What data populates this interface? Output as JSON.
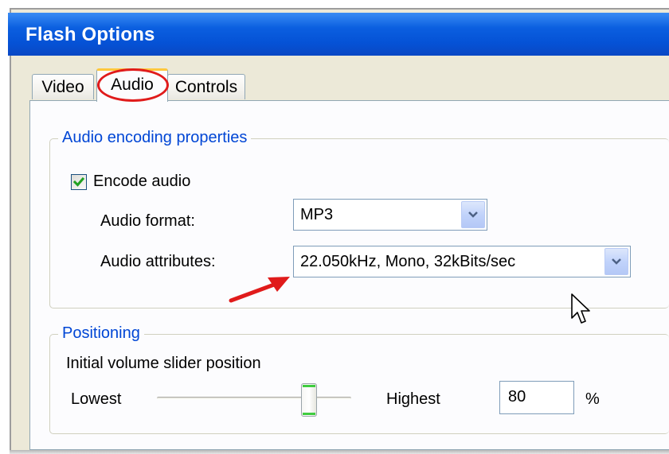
{
  "window": {
    "title": "Flash Options"
  },
  "tabs": [
    {
      "label": "Video",
      "active": false
    },
    {
      "label": "Audio",
      "active": true
    },
    {
      "label": "Controls",
      "active": false
    }
  ],
  "audio_group": {
    "legend": "Audio encoding properties",
    "encode_audio": {
      "label": "Encode audio",
      "checked": true
    },
    "audio_format": {
      "label": "Audio format:",
      "value": "MP3"
    },
    "audio_attributes": {
      "label": "Audio attributes:",
      "value": "22.050kHz, Mono, 32kBits/sec"
    }
  },
  "positioning_group": {
    "legend": "Positioning",
    "slider_caption": "Initial volume slider position",
    "low_label": "Lowest",
    "high_label": "Highest",
    "volume_value": "80",
    "unit": "%",
    "slider_level_percent": 80
  },
  "colors": {
    "titlebar": "#0552d6",
    "legend_text": "#0046d5",
    "highlight_ellipse": "#e01b1b",
    "annotation_arrow": "#e01b1b",
    "active_tab_top": "#ffc83c",
    "slider_thumb_accent": "#3fcc3f"
  },
  "icons": {
    "checkbox_mark": "checkmark-icon",
    "dropdown": "chevron-down-icon",
    "annotation": "red-arrow-icon",
    "pointer": "mouse-cursor-icon"
  }
}
